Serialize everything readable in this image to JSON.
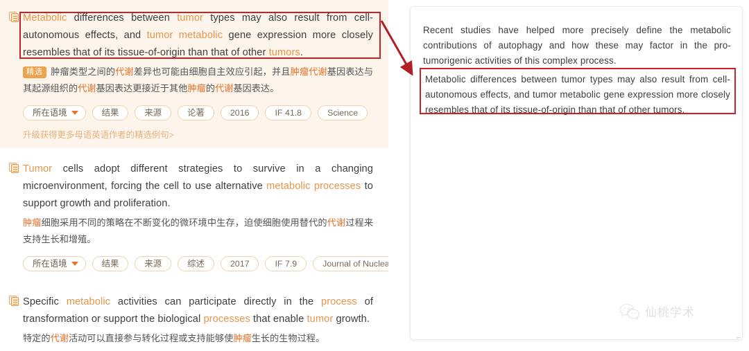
{
  "colors": {
    "accent_orange": "#e8944a",
    "accent_orange_strong": "#e8702a",
    "badge_orange": "#eda24d",
    "annotation_red": "#cc2027",
    "featured_card_bg": "#fdf5ec",
    "chip_border": "#f0d3ad",
    "body_text": "#3d3d3d"
  },
  "left_panel": {
    "cards": [
      {
        "icon": "document-copy-icon",
        "featured": true,
        "featured_badge": "精选",
        "english": [
          {
            "t": "Metabolic",
            "hl": true
          },
          {
            "t": " differences between ",
            "hl": false
          },
          {
            "t": "tumor",
            "hl": true
          },
          {
            "t": " types may also result from cell-autonomous effects, and ",
            "hl": false
          },
          {
            "t": "tumor metabolic",
            "hl": true
          },
          {
            "t": " gene expression more closely resembles that of its tissue-of-origin than that of other ",
            "hl": false
          },
          {
            "t": "tumors",
            "hl": true
          },
          {
            "t": ".",
            "hl": false
          }
        ],
        "chinese": [
          {
            "t": "肿瘤类型之间的",
            "hl": false
          },
          {
            "t": "代谢",
            "hl": true
          },
          {
            "t": "差异也可能由细胞自主效应引起，并且",
            "hl": false
          },
          {
            "t": "肿瘤代谢",
            "hl": true
          },
          {
            "t": "基因表达与其起源组织的",
            "hl": false
          },
          {
            "t": "代谢",
            "hl": true
          },
          {
            "t": "基因表达更接近于其他",
            "hl": false
          },
          {
            "t": "肿瘤",
            "hl": true
          },
          {
            "t": "的",
            "hl": false
          },
          {
            "t": "代谢",
            "hl": true
          },
          {
            "t": "基因表达。",
            "hl": false
          }
        ],
        "chips": [
          "所在语境",
          "结果",
          "来源",
          "论著",
          "2016",
          "IF 41.8",
          "Science"
        ],
        "upgrade_link": "升级获得更多母语英语作者的精选例句>"
      },
      {
        "icon": "document-copy-icon",
        "featured": false,
        "english": [
          {
            "t": "Tumor",
            "hl": true
          },
          {
            "t": " cells adopt different strategies to survive in a changing microenvironment, forcing the cell to use alternative ",
            "hl": false
          },
          {
            "t": "metabolic processes",
            "hl": true
          },
          {
            "t": " to support growth and proliferation.",
            "hl": false
          }
        ],
        "chinese": [
          {
            "t": "肿瘤",
            "hl": true
          },
          {
            "t": "细胞采用不同的策略在不断变化的微环境中生存，迫使细胞使用替代的",
            "hl": false
          },
          {
            "t": "代谢",
            "hl": true
          },
          {
            "t": "过程来支持生长和增殖。",
            "hl": false
          }
        ],
        "chips": [
          "所在语境",
          "结果",
          "来源",
          "综述",
          "2017",
          "IF 7.9",
          "Journal of Nuclea..."
        ]
      },
      {
        "icon": "document-copy-icon",
        "featured": false,
        "english": [
          {
            "t": "Specific ",
            "hl": false
          },
          {
            "t": "metabolic",
            "hl": true
          },
          {
            "t": " activities can participate directly in the ",
            "hl": false
          },
          {
            "t": "process",
            "hl": true
          },
          {
            "t": " of transformation or support the biological ",
            "hl": false
          },
          {
            "t": "processes",
            "hl": true
          },
          {
            "t": " that enable ",
            "hl": false
          },
          {
            "t": "tumor",
            "hl": true
          },
          {
            "t": " growth.",
            "hl": false
          }
        ],
        "chinese": [
          {
            "t": "特定的",
            "hl": false
          },
          {
            "t": "代谢",
            "hl": true
          },
          {
            "t": "活动可以直接参与转化过程或支持能够使",
            "hl": false
          },
          {
            "t": "肿瘤",
            "hl": true
          },
          {
            "t": "生长的生物过程。",
            "hl": false
          }
        ],
        "chips": []
      }
    ]
  },
  "right_panel": {
    "intro_paragraph": "Recent studies have helped more precisely define the metabolic contributions of autophagy and how these may factor in the pro-tumorigenic activities of this complex process.",
    "highlighted_paragraph": "Metabolic differences between tumor types may also result from cell-autonomous effects, and tumor metabolic gene expression more closely resembles that of its tissue-of-origin than that of other tumors."
  },
  "annotations": {
    "arrow": "red-arrow-pointing-to-highlighted-paragraph",
    "left_highlight_box": "red-rectangle-around-first-sentence",
    "right_highlight_box": "red-rectangle-around-matching-source-sentence"
  },
  "watermark": {
    "icon": "wechat-icon",
    "text": "仙桃学术",
    "corner_mark": "⌐"
  }
}
